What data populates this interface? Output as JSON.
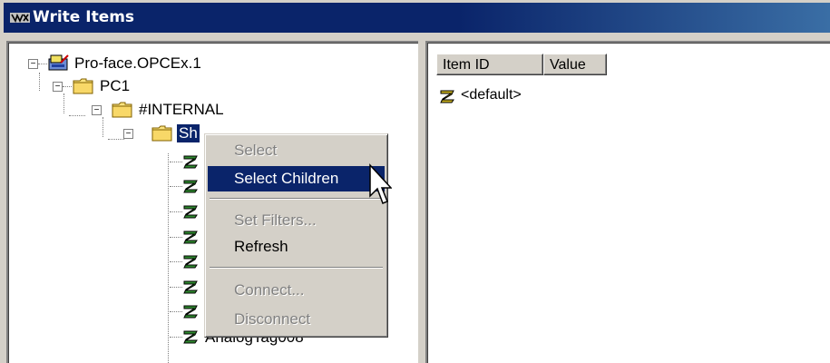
{
  "window": {
    "title": "Write Items"
  },
  "tree": {
    "server": "Pro-face.OPCEx.1",
    "pc": "PC1",
    "internal": "#INTERNAL",
    "selected_folder": "Sh",
    "leaf_visible": "AnalogTag008"
  },
  "list": {
    "columns": [
      "Item ID",
      "Value"
    ],
    "rows": [
      {
        "item_id": "<default>"
      }
    ]
  },
  "context_menu": {
    "items": [
      {
        "label": "Select",
        "enabled": false
      },
      {
        "label": "Select Children",
        "enabled": true,
        "highlighted": true
      },
      {
        "label": "Set Filters...",
        "enabled": false
      },
      {
        "label": "Refresh",
        "enabled": true
      },
      {
        "label": "Connect...",
        "enabled": false
      },
      {
        "label": "Disconnect",
        "enabled": false
      }
    ]
  },
  "colors": {
    "titlebar": "#0a246a",
    "selection": "#0a246a",
    "face": "#d4d0c8"
  },
  "icons": {
    "title": "app-icon",
    "server": "server-icon",
    "folder": "folder-icon",
    "tag": "tag-icon"
  }
}
